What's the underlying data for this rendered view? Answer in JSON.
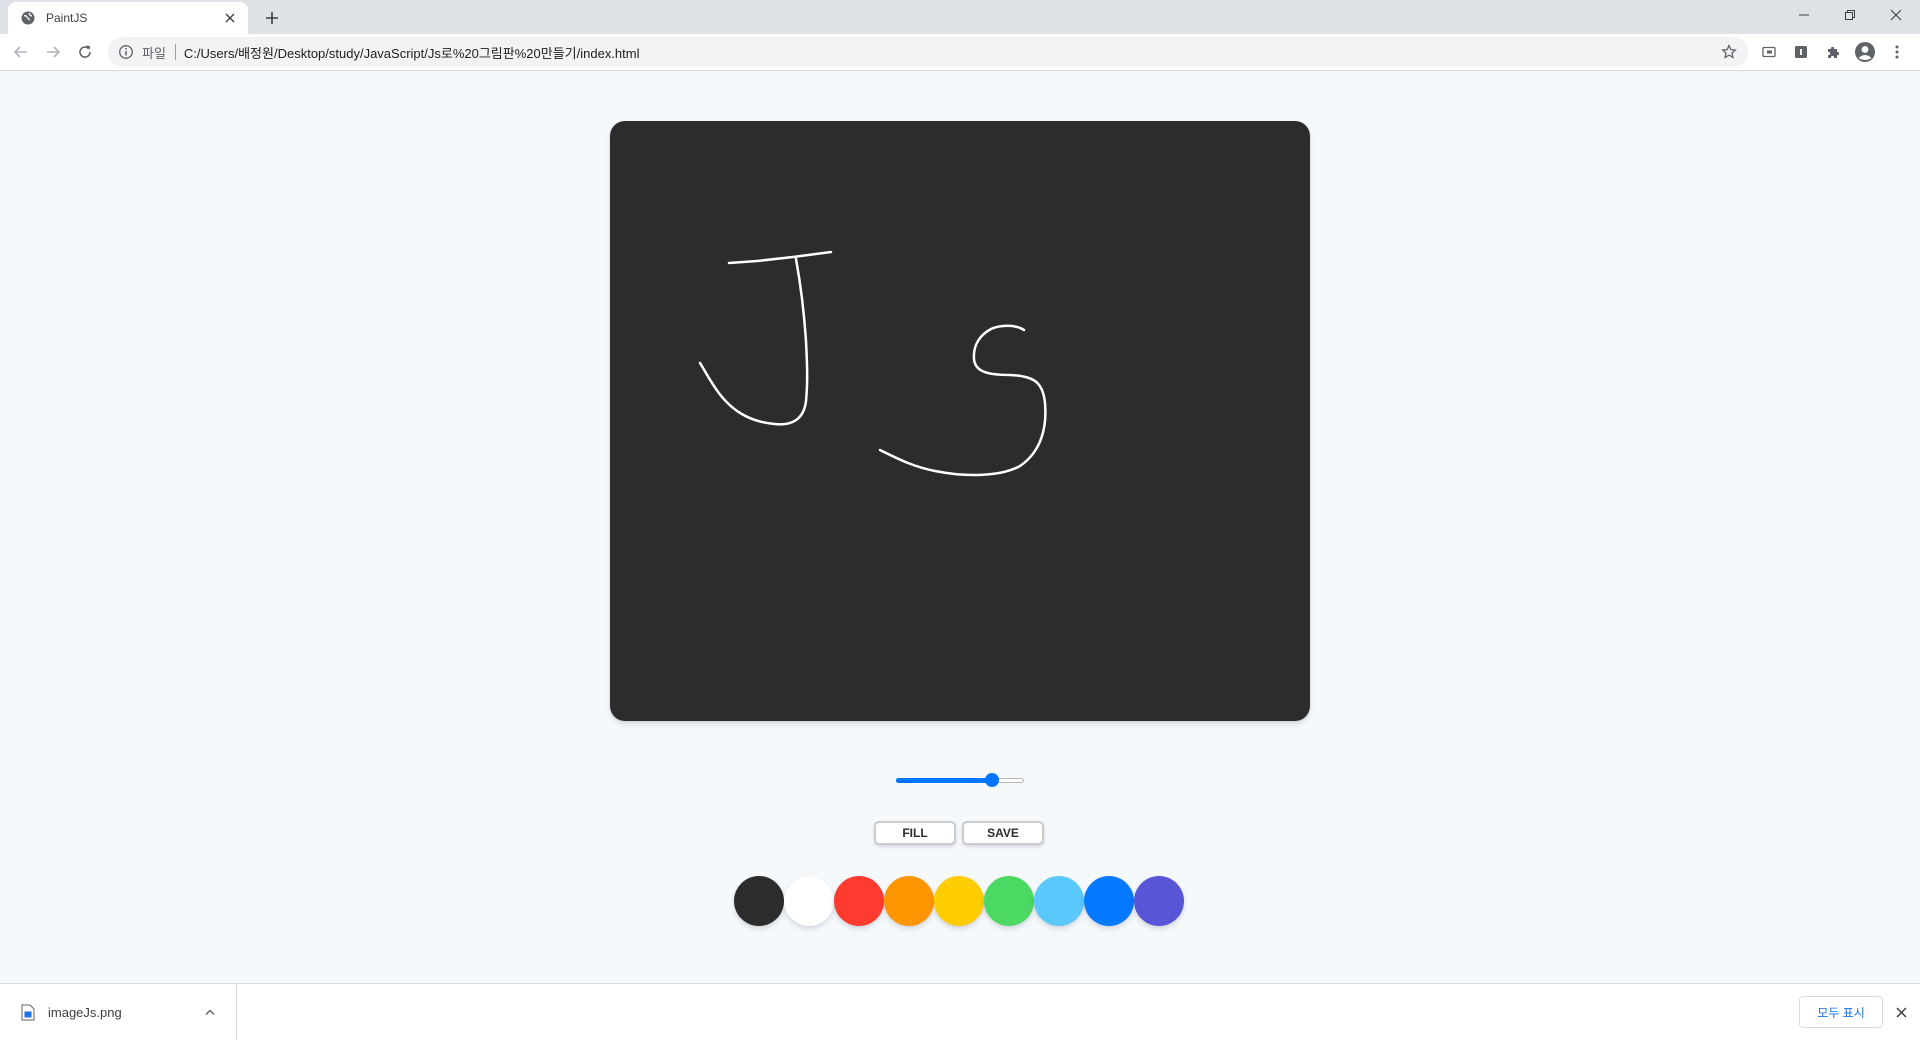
{
  "browser": {
    "tab_title": "PaintJS",
    "scheme_label": "파일",
    "url": "C:/Users/배정원/Desktop/study/JavaScript/Js로%20그림판%20만들기/index.html"
  },
  "controls": {
    "brush_size_fraction": 0.75,
    "fill_label": "FILL",
    "save_label": "SAVE"
  },
  "palette": {
    "colors": [
      "#2c2c2c",
      "#ffffff",
      "#ff3b30",
      "#ff9500",
      "#ffcc00",
      "#4cd963",
      "#5ac8fa",
      "#0579ff",
      "#5856d6"
    ]
  },
  "download_shelf": {
    "file_name": "imageJs.png",
    "show_all_label": "모두 표시"
  }
}
